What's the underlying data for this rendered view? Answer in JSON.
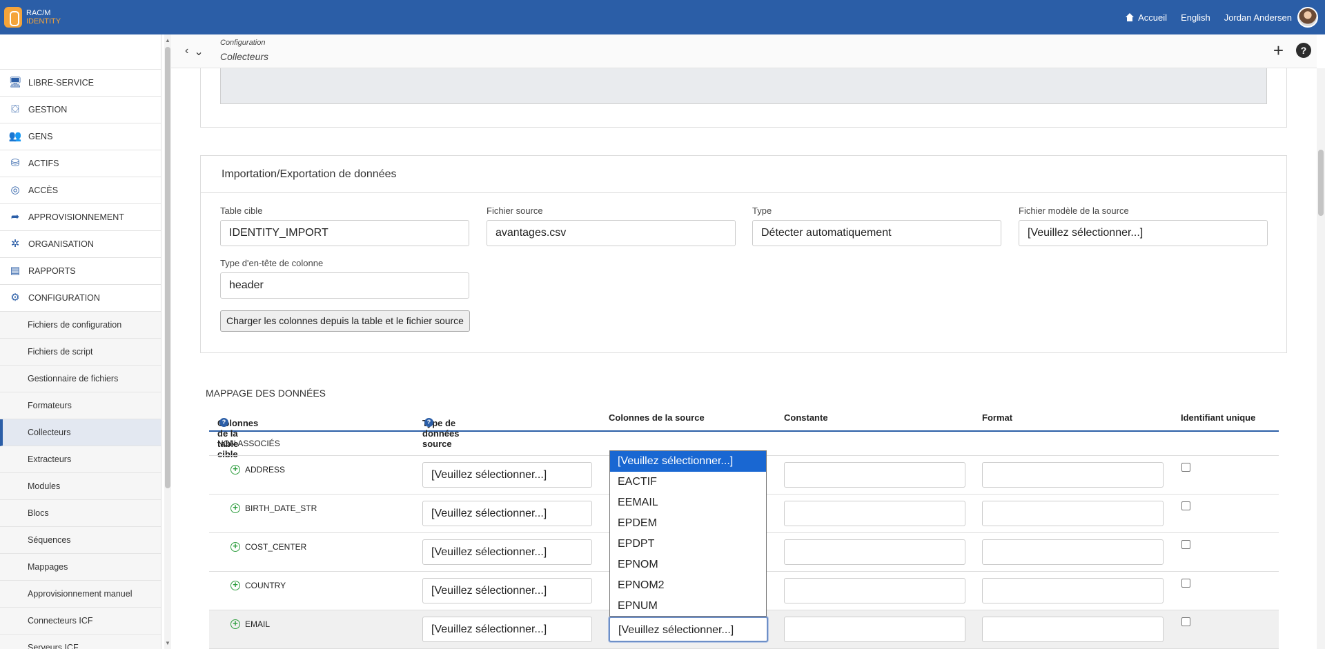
{
  "app": {
    "logo_line1": "RAC/M",
    "logo_line2": "IDENTITY"
  },
  "topnav": {
    "home": "Accueil",
    "language": "English",
    "user": "Jordan Andersen"
  },
  "sidebar": {
    "items": [
      {
        "label": "LIBRE-SERVICE",
        "icon": "monitor-icon"
      },
      {
        "label": "GESTION",
        "icon": "toolbox-icon"
      },
      {
        "label": "GENS",
        "icon": "users-icon"
      },
      {
        "label": "ACTIFS",
        "icon": "database-icon"
      },
      {
        "label": "ACCÈS",
        "icon": "fingerprint-icon"
      },
      {
        "label": "APPROVISIONNEMENT",
        "icon": "share-arrow-icon"
      },
      {
        "label": "ORGANISATION",
        "icon": "network-icon"
      },
      {
        "label": "RAPPORTS",
        "icon": "document-icon"
      },
      {
        "label": "CONFIGURATION",
        "icon": "gears-icon"
      }
    ],
    "subitems": [
      "Fichiers de configuration",
      "Fichiers de script",
      "Gestionnaire de fichiers",
      "Formateurs",
      "Collecteurs",
      "Extracteurs",
      "Modules",
      "Blocs",
      "Séquences",
      "Mappages",
      "Approvisionnement manuel",
      "Connecteurs ICF",
      "Serveurs ICF"
    ],
    "active_subitem": "Collecteurs"
  },
  "breadcrumb": {
    "parent": "Configuration",
    "current": "Collecteurs"
  },
  "import_panel": {
    "title": "Importation/Exportation de données",
    "target_table_label": "Table cible",
    "target_table_value": "IDENTITY_IMPORT",
    "source_file_label": "Fichier source",
    "source_file_value": "avantages.csv",
    "type_label": "Type",
    "type_value": "Détecter automatiquement",
    "template_label": "Fichier modèle de la source",
    "template_value": "[Veuillez sélectionner...]",
    "header_type_label": "Type d'en-tête de colonne",
    "header_type_value": "header",
    "load_button": "Charger les colonnes depuis la table et le fichier source"
  },
  "mapping": {
    "title": "MAPPAGE DES DONNÉES",
    "headers": {
      "target_columns": "Colonnes de la table cible",
      "source_type": "Type de données source",
      "source_columns": "Colonnes de la source",
      "constant": "Constante",
      "format": "Format",
      "unique_id": "Identifiant unique"
    },
    "group": "NON ASSOCIÉS",
    "placeholder": "[Veuillez sélectionner...]",
    "rows": [
      {
        "name": "ADDRESS",
        "source_type": "[Veuillez sélectionner...]"
      },
      {
        "name": "BIRTH_DATE_STR",
        "source_type": "[Veuillez sélectionner...]"
      },
      {
        "name": "COST_CENTER",
        "source_type": "[Veuillez sélectionner...]"
      },
      {
        "name": "COUNTRY",
        "source_type": "[Veuillez sélectionner...]"
      },
      {
        "name": "EMAIL",
        "source_type": "[Veuillez sélectionner...]",
        "source_column": "[Veuillez sélectionner...]"
      }
    ],
    "dropdown_options": [
      "[Veuillez sélectionner...]",
      "EACTIF",
      "EEMAIL",
      "EPDEM",
      "EPDPT",
      "EPNOM",
      "EPNOM2",
      "EPNUM"
    ],
    "dropdown_selected": "[Veuillez sélectionner...]"
  },
  "colors": {
    "brand": "#2b5ea7",
    "accent": "#f5a43a",
    "selection": "#1967d2",
    "add": "#2e9e3e"
  }
}
